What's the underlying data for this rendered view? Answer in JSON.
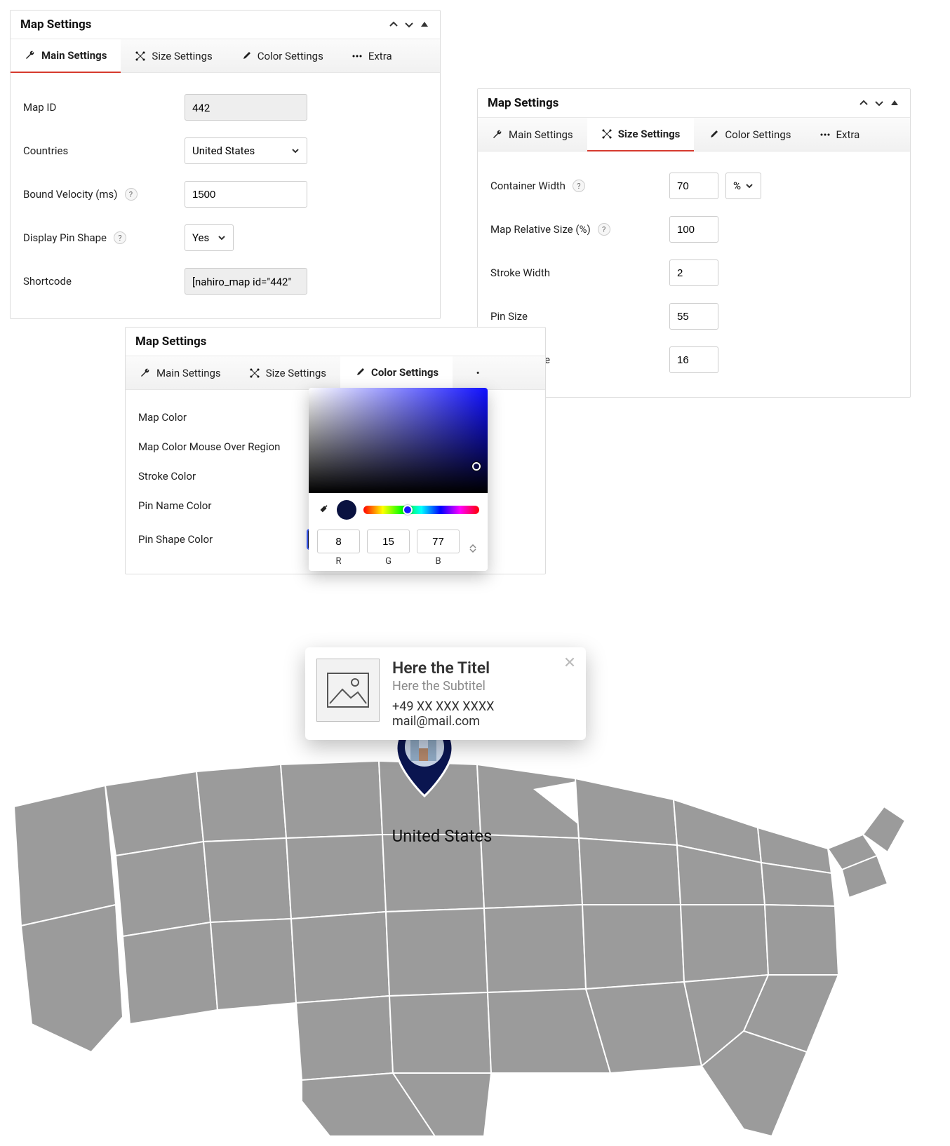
{
  "tabs": {
    "main": "Main Settings",
    "size": "Size Settings",
    "color": "Color Settings",
    "extra": "Extra"
  },
  "panel1": {
    "title": "Map Settings",
    "fields": {
      "map_id_label": "Map ID",
      "map_id_value": "442",
      "countries_label": "Countries",
      "countries_value": "United States",
      "bound_velocity_label": "Bound Velocity (ms)",
      "bound_velocity_value": "1500",
      "display_pin_shape_label": "Display Pin Shape",
      "display_pin_shape_value": "Yes",
      "shortcode_label": "Shortcode",
      "shortcode_value": "[nahiro_map id=\"442\""
    }
  },
  "panel2": {
    "title": "Map Settings",
    "fields": {
      "container_width_label": "Container Width",
      "container_width_value": "70",
      "container_width_unit": "%",
      "map_rel_size_label": "Map Relative Size (%)",
      "map_rel_size_value": "100",
      "stroke_width_label": "Stroke Width",
      "stroke_width_value": "2",
      "pin_size_label": "Pin Size",
      "pin_size_value": "55",
      "pin_text_size_label": "Pin Text Size",
      "pin_text_size_value": "16"
    }
  },
  "panel3": {
    "title": "Map Settings",
    "fields": {
      "map_color_label": "Map Color",
      "map_color_mouseover_label": "Map Color Mouse Over Region",
      "stroke_color_label": "Stroke Color",
      "pin_name_color_label": "Pin Name Color",
      "pin_shape_color_label": "Pin Shape Color",
      "pin_shape_color_value": "#08114d"
    }
  },
  "color_picker": {
    "r": "8",
    "g": "15",
    "b": "77",
    "label_r": "R",
    "label_g": "G",
    "label_b": "B"
  },
  "tooltip": {
    "title": "Here the Titel",
    "subtitle": "Here the Subtitel",
    "phone": "+49 XX XXX XXXX",
    "email": "mail@mail.com"
  },
  "map": {
    "pin_label": "United States"
  }
}
